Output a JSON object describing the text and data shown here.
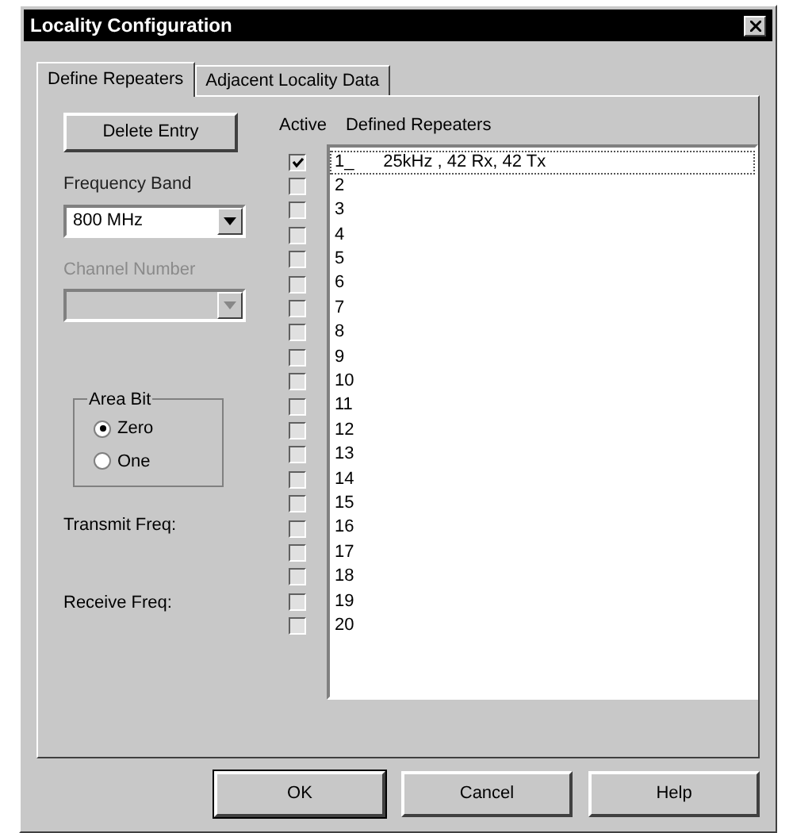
{
  "window": {
    "title": "Locality Configuration"
  },
  "tabs": [
    {
      "label": "Define Repeaters",
      "selected": true
    },
    {
      "label": "Adjacent Locality Data",
      "selected": false
    }
  ],
  "delete_button": "Delete Entry",
  "frequency_band": {
    "label": "Frequency Band",
    "value": "800 MHz",
    "disabled": false
  },
  "channel_number": {
    "label": "Channel Number",
    "disabled": true
  },
  "area_bit": {
    "label": "Area Bit",
    "options": [
      {
        "label": "Zero",
        "selected": true
      },
      {
        "label": "One",
        "selected": false
      }
    ]
  },
  "transmit_freq_label": "Transmit Freq:",
  "receive_freq_label": "Receive Freq:",
  "repeaters": {
    "active_header": "Active",
    "list_header": "Defined Repeaters",
    "rows": [
      {
        "text": "1_      25kHz , 42 Rx, 42 Tx",
        "active": true,
        "selected": true
      },
      {
        "text": "2",
        "active": false,
        "selected": false
      },
      {
        "text": "3",
        "active": false,
        "selected": false
      },
      {
        "text": "4",
        "active": false,
        "selected": false
      },
      {
        "text": "5",
        "active": false,
        "selected": false
      },
      {
        "text": "6",
        "active": false,
        "selected": false
      },
      {
        "text": "7",
        "active": false,
        "selected": false
      },
      {
        "text": "8",
        "active": false,
        "selected": false
      },
      {
        "text": "9",
        "active": false,
        "selected": false
      },
      {
        "text": "10",
        "active": false,
        "selected": false
      },
      {
        "text": "11",
        "active": false,
        "selected": false
      },
      {
        "text": "12",
        "active": false,
        "selected": false
      },
      {
        "text": "13",
        "active": false,
        "selected": false
      },
      {
        "text": "14",
        "active": false,
        "selected": false
      },
      {
        "text": "15",
        "active": false,
        "selected": false
      },
      {
        "text": "16",
        "active": false,
        "selected": false
      },
      {
        "text": "17",
        "active": false,
        "selected": false
      },
      {
        "text": "18",
        "active": false,
        "selected": false
      },
      {
        "text": "19",
        "active": false,
        "selected": false
      },
      {
        "text": "20",
        "active": false,
        "selected": false
      }
    ]
  },
  "buttons": [
    "OK",
    "Cancel",
    "Help"
  ]
}
